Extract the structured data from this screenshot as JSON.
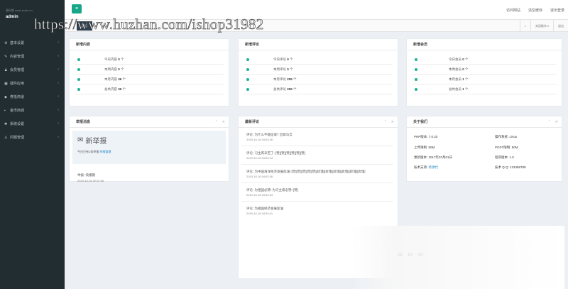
{
  "sidebar": {
    "logo_text": "源码吧 www.xxdm.cn",
    "user": "admin",
    "items": [
      {
        "icon": "gear-icon",
        "glyph": "⚙",
        "label": "基本设置"
      },
      {
        "icon": "edit-icon",
        "glyph": "✎",
        "label": "内容管理"
      },
      {
        "icon": "user-icon",
        "glyph": "♟",
        "label": "会员管理"
      },
      {
        "icon": "plugin-icon",
        "glyph": "▣",
        "label": "插件应用"
      },
      {
        "icon": "tag-icon",
        "glyph": "◆",
        "label": "券抵商道"
      },
      {
        "icon": "cart-icon",
        "glyph": "▪",
        "label": "金币商城"
      },
      {
        "icon": "cog-icon",
        "glyph": "✱",
        "label": "系统设置"
      },
      {
        "icon": "users-icon",
        "glyph": "♙",
        "label": "问题管理"
      }
    ]
  },
  "header": {
    "toggle_glyph": "≡",
    "links": [
      "访问网站",
      "清空缓存",
      "退出登录"
    ]
  },
  "tabs": {
    "prev_glyph": "«",
    "home": "首页",
    "next_glyph": "»",
    "close_ops": "关闭操作 ▾",
    "exit": "退出"
  },
  "watermark": "https://www.huzhan.com/ishop31982",
  "content_stats": {
    "title": "新增内容",
    "rows": [
      {
        "label": "今日内容",
        "value": "0",
        "unit": "个"
      },
      {
        "label": "本周内容",
        "value": "0",
        "unit": "个"
      },
      {
        "label": "本月内容",
        "value": "36",
        "unit": "个"
      },
      {
        "label": "总共内容",
        "value": "36",
        "unit": "个"
      }
    ]
  },
  "comment_stats": {
    "title": "新增评论",
    "rows": [
      {
        "label": "今日评论",
        "value": "0",
        "unit": "个"
      },
      {
        "label": "本周评论",
        "value": "0",
        "unit": "个"
      },
      {
        "label": "本月评论",
        "value": "205",
        "unit": "个"
      },
      {
        "label": "总共评论",
        "value": "205",
        "unit": "个"
      }
    ]
  },
  "member_stats": {
    "title": "新增会员",
    "rows": [
      {
        "label": "今日会员",
        "value": "0",
        "unit": "个"
      },
      {
        "label": "本周会员",
        "value": "0",
        "unit": "个"
      },
      {
        "label": "本月会员",
        "value": "1",
        "unit": "个"
      },
      {
        "label": "总共会员",
        "value": "1",
        "unit": "个"
      }
    ]
  },
  "report": {
    "title": "举报消息",
    "head": "新举报",
    "sub_prefix": "今日已有1条举报,",
    "sub_link": "举报管理",
    "item": "举报: 快播键",
    "time": "2019-10-16 02:22:40"
  },
  "comments": {
    "title": "最新评论",
    "items": [
      {
        "text": "评论: 为什么不能征收7 出如马云",
        "time": "2019-10-16 04:52:26"
      },
      {
        "text": "评论: 习主席辛苦了: [赞][赞][赞][赞][赞][赞]",
        "time": "2019-10-16 04:54:24"
      },
      {
        "text": "评论: 为中国海洋经济发展加油! [赞][赞][赞][赞][赞][玫瑰][玫瑰][玫瑰][玫瑰][玫瑰][玫瑰]",
        "time": "2019-10-16 04:52:36"
      },
      {
        "text": "评论: 为祖国必赞! 为习主席必赞! [赞]",
        "time": "2019-10-16 04:52:04"
      },
      {
        "text": "评论: 为祖国经济发展加油",
        "time": "2019-10-16 04:53:41"
      }
    ]
  },
  "about": {
    "title": "关于我们",
    "php_label": "PHP版本:",
    "php": "7.0.33",
    "os_label": "操作系统:",
    "os": "Linux",
    "upload_label": "上传限制:",
    "upload": "50M",
    "post_label": "POST限制:",
    "post": "50M",
    "update_label": "更新版本:",
    "update": "2017年07月01日",
    "program_label": "程序版本:",
    "program": "1.0",
    "support_label": "技术支持:",
    "support": "新源代",
    "qq_label": "技术 Q Q:",
    "qq": "123456789"
  },
  "colors": {
    "sidebar": "#222d32",
    "accent": "#18a689",
    "link": "#1c84c6"
  }
}
